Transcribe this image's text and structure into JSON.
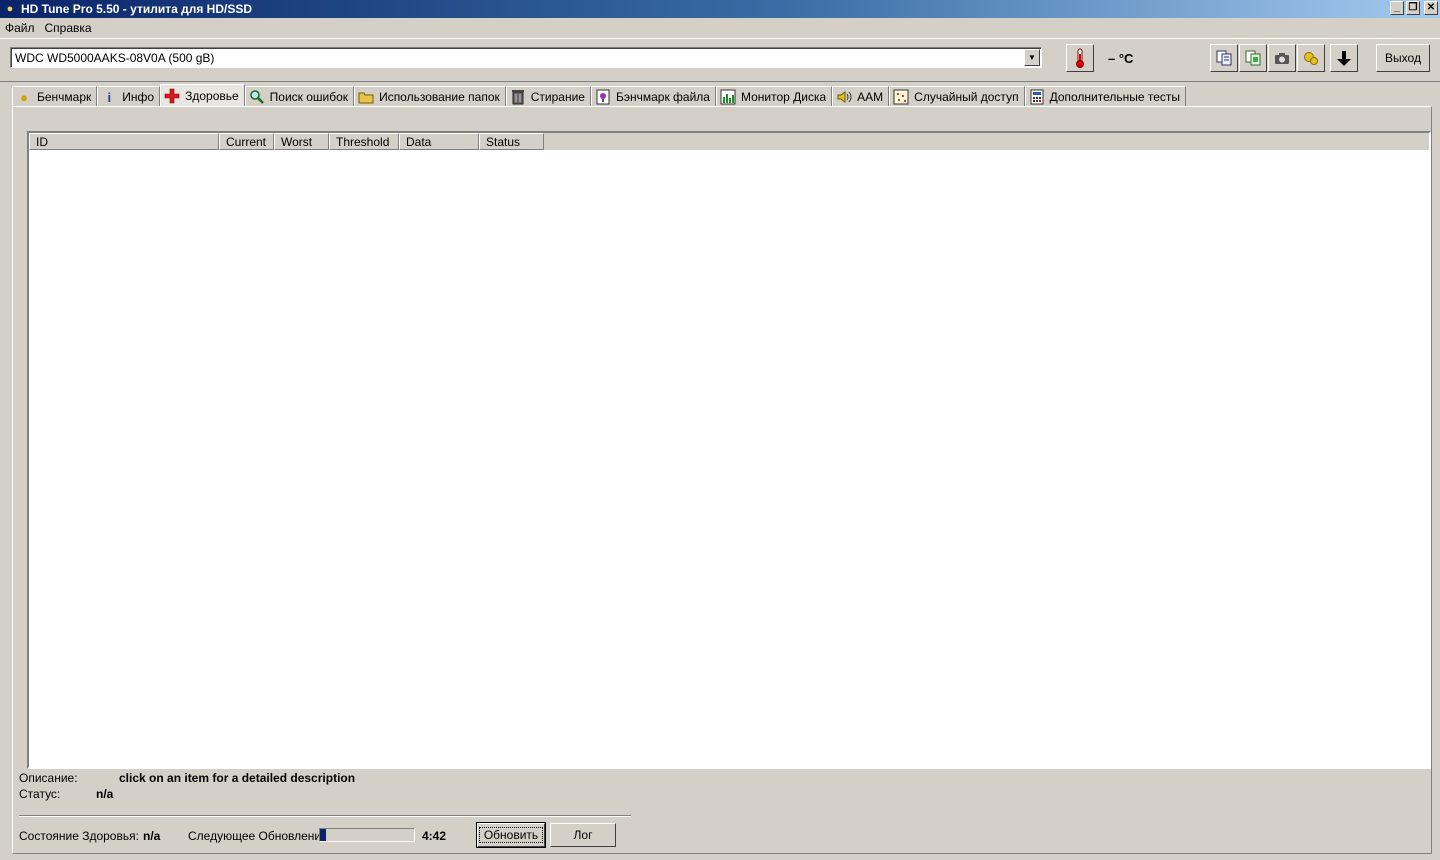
{
  "window": {
    "title": "HD Tune Pro 5.50 - утилита для HD/SSD",
    "controls": {
      "minimize": "_",
      "restore": "❐",
      "close": "✕"
    }
  },
  "menu": {
    "items": [
      "Файл",
      "Справка"
    ]
  },
  "toolbar": {
    "drive": "WDC WD5000AAKS-08V0A (500 gB)",
    "temperature": "– °C",
    "exit_label": "Выход",
    "icons": [
      "thermometer-icon",
      "copy-text-icon",
      "copy-screenshot-icon",
      "camera-icon",
      "options-icon",
      "save-icon"
    ]
  },
  "tabs": [
    {
      "label": "Бенчмарк",
      "icon": "bulb-icon"
    },
    {
      "label": "Инфо",
      "icon": "info-icon"
    },
    {
      "label": "Здоровье",
      "icon": "health-cross-icon",
      "active": true
    },
    {
      "label": "Поиск ошибок",
      "icon": "magnifier-icon"
    },
    {
      "label": "Использование папок",
      "icon": "folder-icon"
    },
    {
      "label": "Стирание",
      "icon": "trash-icon"
    },
    {
      "label": "Бэнчмарк файла",
      "icon": "file-bulb-icon"
    },
    {
      "label": "Монитор Диска",
      "icon": "monitor-chart-icon"
    },
    {
      "label": "AAM",
      "icon": "speaker-icon"
    },
    {
      "label": "Случайный доступ",
      "icon": "random-access-icon"
    },
    {
      "label": "Дополнительные  тесты",
      "icon": "calculator-icon"
    }
  ],
  "health": {
    "columns": [
      "ID",
      "Current",
      "Worst",
      "Threshold",
      "Data",
      "Status"
    ],
    "rows": [],
    "description_label": "Описание:",
    "description_value": "click on an item for a detailed description",
    "status_label": "Статус:",
    "status_value": "n/a",
    "health_state_label": "Состояние Здоровья:",
    "health_state_value": "n/a",
    "next_update_label": "Следующее Обновление:",
    "next_update_progress": 0.06,
    "next_update_time": "4:42",
    "refresh_label": "Обновить",
    "log_label": "Лог"
  }
}
